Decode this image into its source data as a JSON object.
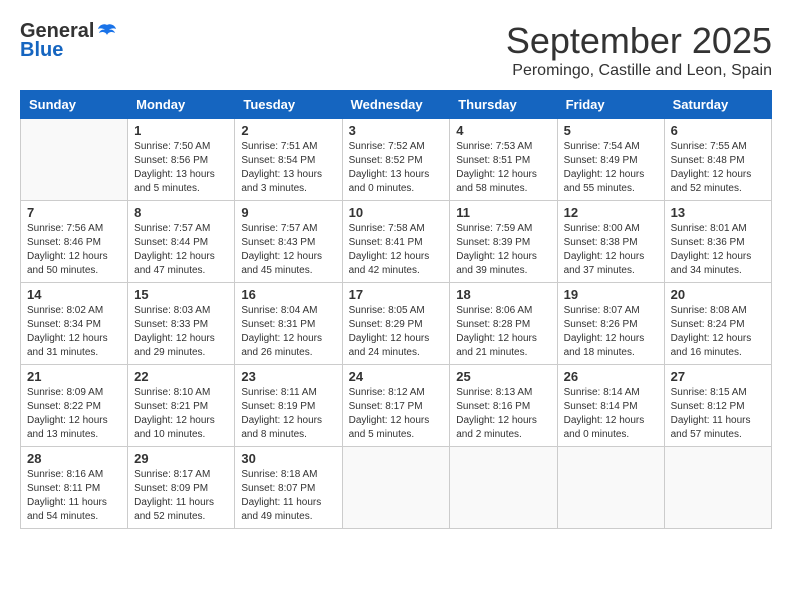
{
  "logo": {
    "general": "General",
    "blue": "Blue"
  },
  "title": {
    "month_year": "September 2025",
    "location": "Peromingo, Castille and Leon, Spain"
  },
  "headers": [
    "Sunday",
    "Monday",
    "Tuesday",
    "Wednesday",
    "Thursday",
    "Friday",
    "Saturday"
  ],
  "weeks": [
    [
      {
        "num": "",
        "sunrise": "",
        "sunset": "",
        "daylight": "",
        "empty": true
      },
      {
        "num": "1",
        "sunrise": "Sunrise: 7:50 AM",
        "sunset": "Sunset: 8:56 PM",
        "daylight": "Daylight: 13 hours and 5 minutes."
      },
      {
        "num": "2",
        "sunrise": "Sunrise: 7:51 AM",
        "sunset": "Sunset: 8:54 PM",
        "daylight": "Daylight: 13 hours and 3 minutes."
      },
      {
        "num": "3",
        "sunrise": "Sunrise: 7:52 AM",
        "sunset": "Sunset: 8:52 PM",
        "daylight": "Daylight: 13 hours and 0 minutes."
      },
      {
        "num": "4",
        "sunrise": "Sunrise: 7:53 AM",
        "sunset": "Sunset: 8:51 PM",
        "daylight": "Daylight: 12 hours and 58 minutes."
      },
      {
        "num": "5",
        "sunrise": "Sunrise: 7:54 AM",
        "sunset": "Sunset: 8:49 PM",
        "daylight": "Daylight: 12 hours and 55 minutes."
      },
      {
        "num": "6",
        "sunrise": "Sunrise: 7:55 AM",
        "sunset": "Sunset: 8:48 PM",
        "daylight": "Daylight: 12 hours and 52 minutes."
      }
    ],
    [
      {
        "num": "7",
        "sunrise": "Sunrise: 7:56 AM",
        "sunset": "Sunset: 8:46 PM",
        "daylight": "Daylight: 12 hours and 50 minutes."
      },
      {
        "num": "8",
        "sunrise": "Sunrise: 7:57 AM",
        "sunset": "Sunset: 8:44 PM",
        "daylight": "Daylight: 12 hours and 47 minutes."
      },
      {
        "num": "9",
        "sunrise": "Sunrise: 7:57 AM",
        "sunset": "Sunset: 8:43 PM",
        "daylight": "Daylight: 12 hours and 45 minutes."
      },
      {
        "num": "10",
        "sunrise": "Sunrise: 7:58 AM",
        "sunset": "Sunset: 8:41 PM",
        "daylight": "Daylight: 12 hours and 42 minutes."
      },
      {
        "num": "11",
        "sunrise": "Sunrise: 7:59 AM",
        "sunset": "Sunset: 8:39 PM",
        "daylight": "Daylight: 12 hours and 39 minutes."
      },
      {
        "num": "12",
        "sunrise": "Sunrise: 8:00 AM",
        "sunset": "Sunset: 8:38 PM",
        "daylight": "Daylight: 12 hours and 37 minutes."
      },
      {
        "num": "13",
        "sunrise": "Sunrise: 8:01 AM",
        "sunset": "Sunset: 8:36 PM",
        "daylight": "Daylight: 12 hours and 34 minutes."
      }
    ],
    [
      {
        "num": "14",
        "sunrise": "Sunrise: 8:02 AM",
        "sunset": "Sunset: 8:34 PM",
        "daylight": "Daylight: 12 hours and 31 minutes."
      },
      {
        "num": "15",
        "sunrise": "Sunrise: 8:03 AM",
        "sunset": "Sunset: 8:33 PM",
        "daylight": "Daylight: 12 hours and 29 minutes."
      },
      {
        "num": "16",
        "sunrise": "Sunrise: 8:04 AM",
        "sunset": "Sunset: 8:31 PM",
        "daylight": "Daylight: 12 hours and 26 minutes."
      },
      {
        "num": "17",
        "sunrise": "Sunrise: 8:05 AM",
        "sunset": "Sunset: 8:29 PM",
        "daylight": "Daylight: 12 hours and 24 minutes."
      },
      {
        "num": "18",
        "sunrise": "Sunrise: 8:06 AM",
        "sunset": "Sunset: 8:28 PM",
        "daylight": "Daylight: 12 hours and 21 minutes."
      },
      {
        "num": "19",
        "sunrise": "Sunrise: 8:07 AM",
        "sunset": "Sunset: 8:26 PM",
        "daylight": "Daylight: 12 hours and 18 minutes."
      },
      {
        "num": "20",
        "sunrise": "Sunrise: 8:08 AM",
        "sunset": "Sunset: 8:24 PM",
        "daylight": "Daylight: 12 hours and 16 minutes."
      }
    ],
    [
      {
        "num": "21",
        "sunrise": "Sunrise: 8:09 AM",
        "sunset": "Sunset: 8:22 PM",
        "daylight": "Daylight: 12 hours and 13 minutes."
      },
      {
        "num": "22",
        "sunrise": "Sunrise: 8:10 AM",
        "sunset": "Sunset: 8:21 PM",
        "daylight": "Daylight: 12 hours and 10 minutes."
      },
      {
        "num": "23",
        "sunrise": "Sunrise: 8:11 AM",
        "sunset": "Sunset: 8:19 PM",
        "daylight": "Daylight: 12 hours and 8 minutes."
      },
      {
        "num": "24",
        "sunrise": "Sunrise: 8:12 AM",
        "sunset": "Sunset: 8:17 PM",
        "daylight": "Daylight: 12 hours and 5 minutes."
      },
      {
        "num": "25",
        "sunrise": "Sunrise: 8:13 AM",
        "sunset": "Sunset: 8:16 PM",
        "daylight": "Daylight: 12 hours and 2 minutes."
      },
      {
        "num": "26",
        "sunrise": "Sunrise: 8:14 AM",
        "sunset": "Sunset: 8:14 PM",
        "daylight": "Daylight: 12 hours and 0 minutes."
      },
      {
        "num": "27",
        "sunrise": "Sunrise: 8:15 AM",
        "sunset": "Sunset: 8:12 PM",
        "daylight": "Daylight: 11 hours and 57 minutes."
      }
    ],
    [
      {
        "num": "28",
        "sunrise": "Sunrise: 8:16 AM",
        "sunset": "Sunset: 8:11 PM",
        "daylight": "Daylight: 11 hours and 54 minutes."
      },
      {
        "num": "29",
        "sunrise": "Sunrise: 8:17 AM",
        "sunset": "Sunset: 8:09 PM",
        "daylight": "Daylight: 11 hours and 52 minutes."
      },
      {
        "num": "30",
        "sunrise": "Sunrise: 8:18 AM",
        "sunset": "Sunset: 8:07 PM",
        "daylight": "Daylight: 11 hours and 49 minutes."
      },
      {
        "num": "",
        "sunrise": "",
        "sunset": "",
        "daylight": "",
        "empty": true
      },
      {
        "num": "",
        "sunrise": "",
        "sunset": "",
        "daylight": "",
        "empty": true
      },
      {
        "num": "",
        "sunrise": "",
        "sunset": "",
        "daylight": "",
        "empty": true
      },
      {
        "num": "",
        "sunrise": "",
        "sunset": "",
        "daylight": "",
        "empty": true
      }
    ]
  ]
}
